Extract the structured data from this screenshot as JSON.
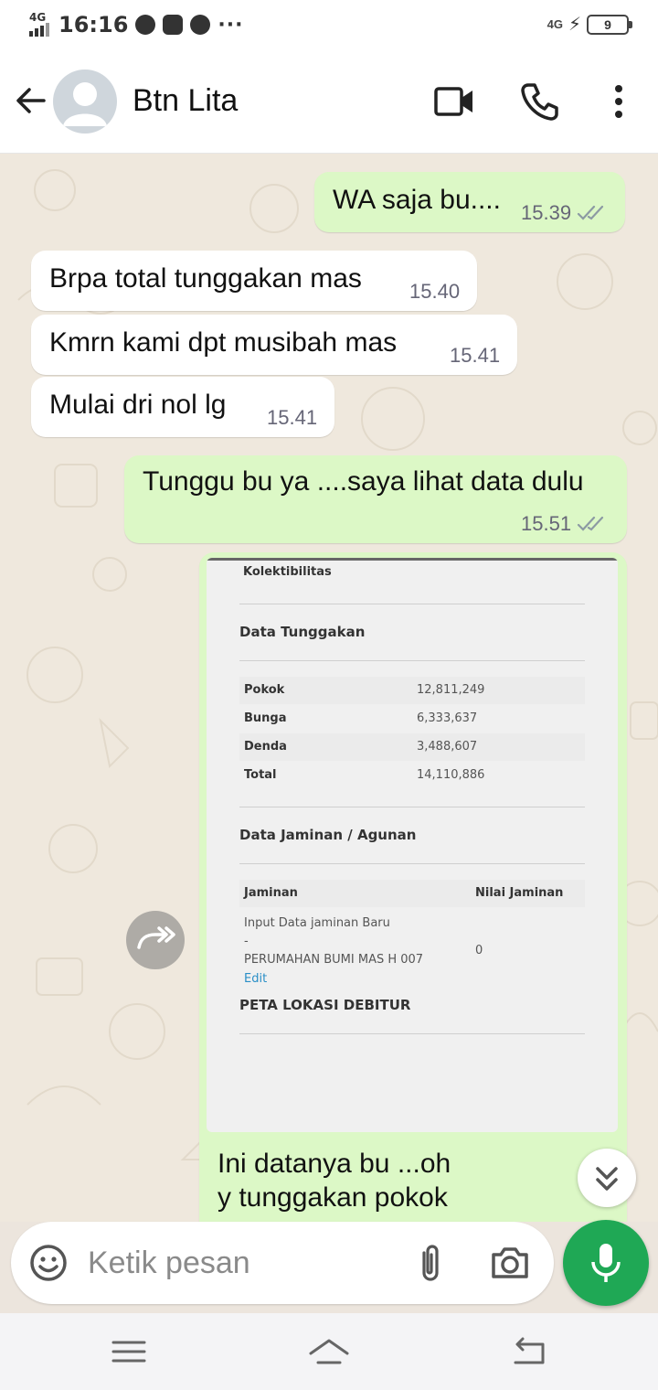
{
  "status_bar": {
    "network": "4G",
    "time": "16:16",
    "more": "···",
    "network_right": "4G",
    "battery": "9"
  },
  "header": {
    "contact_name": "Btn Lita"
  },
  "messages": [
    {
      "text": "WA saja bu....",
      "time": "15.39",
      "direction": "outgoing",
      "status": "read"
    },
    {
      "text": "Brpa total tunggakan mas",
      "time": "15.40",
      "direction": "incoming"
    },
    {
      "text": "Kmrn kami dpt musibah mas",
      "time": "15.41",
      "direction": "incoming"
    },
    {
      "text": "Mulai dri nol lg",
      "time": "15.41",
      "direction": "incoming"
    },
    {
      "text": "Tunggu bu ya ....saya lihat data dulu",
      "time": "15.51",
      "direction": "outgoing",
      "status": "read"
    }
  ],
  "image_message": {
    "caption_line1": "Ini datanya bu ...oh",
    "caption_line2": "y tunggakan pokok",
    "screenshot": {
      "top_label": "Kolektibilitas",
      "section1_title": "Data Tunggakan",
      "rows": [
        {
          "label": "Pokok",
          "value": "12,811,249"
        },
        {
          "label": "Bunga",
          "value": "6,333,637"
        },
        {
          "label": "Denda",
          "value": "3,488,607"
        },
        {
          "label": "Total",
          "value": "14,110,886"
        }
      ],
      "section2_title": "Data Jaminan / Agunan",
      "col_jaminan": "Jaminan",
      "col_nilai": "Nilai Jaminan",
      "jaminan_line1": "Input Data jaminan Baru",
      "jaminan_line2": "-",
      "jaminan_line3": "PERUMAHAN BUMI MAS H 007",
      "jaminan_value": "0",
      "edit_link": "Edit",
      "section3_title": "PETA LOKASI DEBITUR"
    }
  },
  "composer": {
    "placeholder": "Ketik pesan"
  },
  "colors": {
    "outgoing_bubble": "#dcf8c6",
    "incoming_bubble": "#ffffff",
    "mic_button": "#1fa855",
    "read_ticks": "#8c9aa3"
  },
  "icons": [
    "back-arrow-icon",
    "video-call-icon",
    "phone-icon",
    "more-vert-icon",
    "forward-icon",
    "scroll-down-icon",
    "emoji-icon",
    "attach-icon",
    "camera-icon",
    "mic-icon",
    "nav-menu-icon",
    "nav-home-icon",
    "nav-back-icon"
  ]
}
